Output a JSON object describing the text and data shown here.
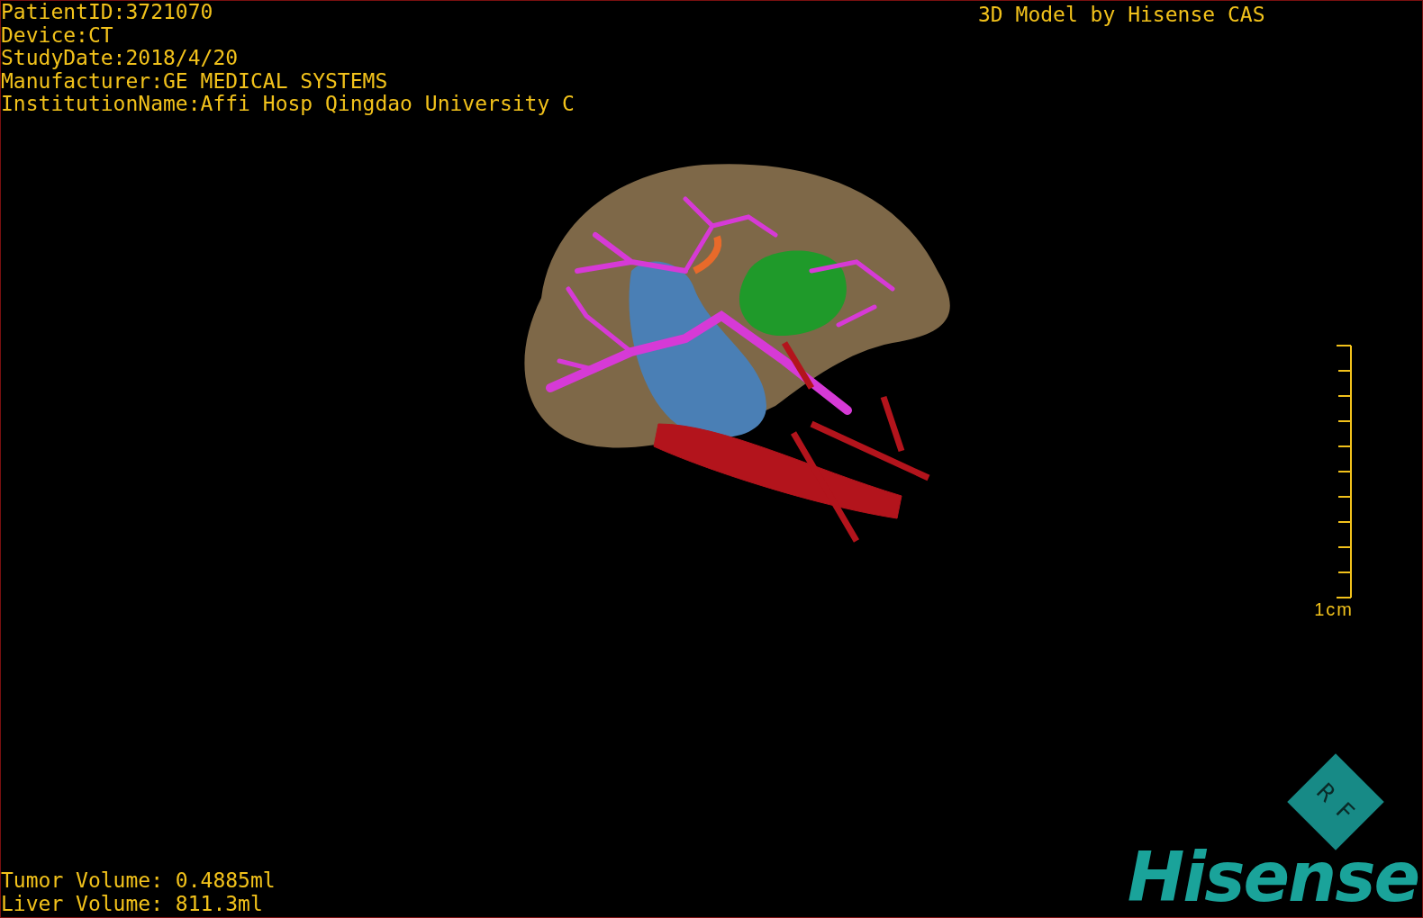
{
  "patient_info": [
    "PatientID:3721070",
    "Device:CT",
    "StudyDate:2018/4/20",
    "Manufacturer:GE MEDICAL SYSTEMS",
    "InstitutionName:Affi Hosp Qingdao University C"
  ],
  "title": "3D Model by Hisense CAS",
  "scale_bar": {
    "label": "1cm"
  },
  "orientation_marker": {
    "labels": [
      "R",
      "F"
    ]
  },
  "volumes": [
    "Tumor Volume: 0.4885ml",
    "Liver Volume: 811.3ml"
  ],
  "logo": {
    "text": "Hisense"
  }
}
